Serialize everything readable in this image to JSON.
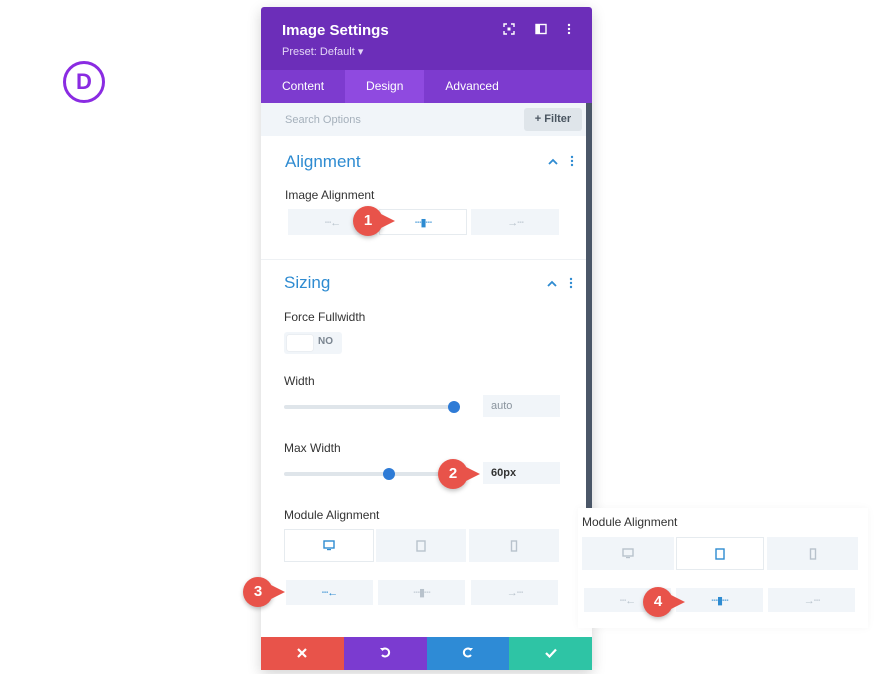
{
  "logo": {
    "letter": "D"
  },
  "header": {
    "title": "Image Settings",
    "preset": "Preset: Default ▾"
  },
  "tabs": [
    "Content",
    "Design",
    "Advanced"
  ],
  "search": {
    "placeholder": "Search Options"
  },
  "filter_label": "Filter",
  "alignment": {
    "title": "Alignment",
    "image_alignment_label": "Image Alignment"
  },
  "sizing": {
    "title": "Sizing",
    "force_fullwidth_label": "Force Fullwidth",
    "toggle_value": "NO",
    "width_label": "Width",
    "width_value": "auto",
    "max_width_label": "Max Width",
    "max_width_value": "60px",
    "module_alignment_label": "Module Alignment"
  },
  "overlay": {
    "module_alignment_label": "Module Alignment"
  },
  "callouts": [
    "1",
    "2",
    "3",
    "4"
  ],
  "colors": {
    "header": "#6c2eb9",
    "tabs": "#7d3bcf",
    "active_tab": "#8f4ae0",
    "accent": "#2e8bd1",
    "cancel": "#e8534a",
    "undo": "#7b3bd0",
    "redo": "#2e8bd6",
    "save": "#2ec4a5"
  }
}
